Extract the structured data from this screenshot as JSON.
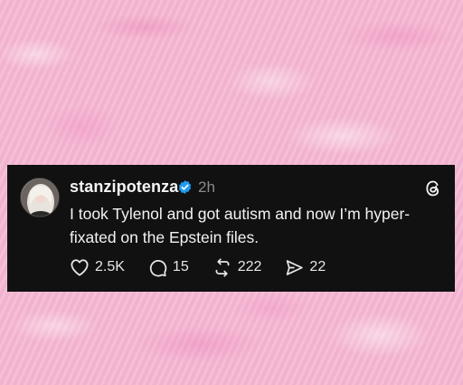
{
  "post": {
    "username": "stanzipotenza",
    "time": "2h",
    "text": "I took Tylenol and got autism and now I’m hyper-fixated on the Epstein files.",
    "text_line1": "I took Tylenol and got autism and now I’m hyper-",
    "text_line2": "fixated on the Epstein files.",
    "stats": {
      "likes": "2.5K",
      "replies": "15",
      "reposts": "222",
      "shares": "22"
    }
  },
  "icons": {
    "verified": "verified-badge-icon",
    "logo": "threads-logo-icon",
    "like": "heart-icon",
    "reply": "comment-icon",
    "repost": "repost-icon",
    "share": "send-icon"
  },
  "colors": {
    "background": "#f4b8d3",
    "card": "#111111",
    "verified": "#1d9bf0",
    "muted_text": "#8a8a8a"
  }
}
